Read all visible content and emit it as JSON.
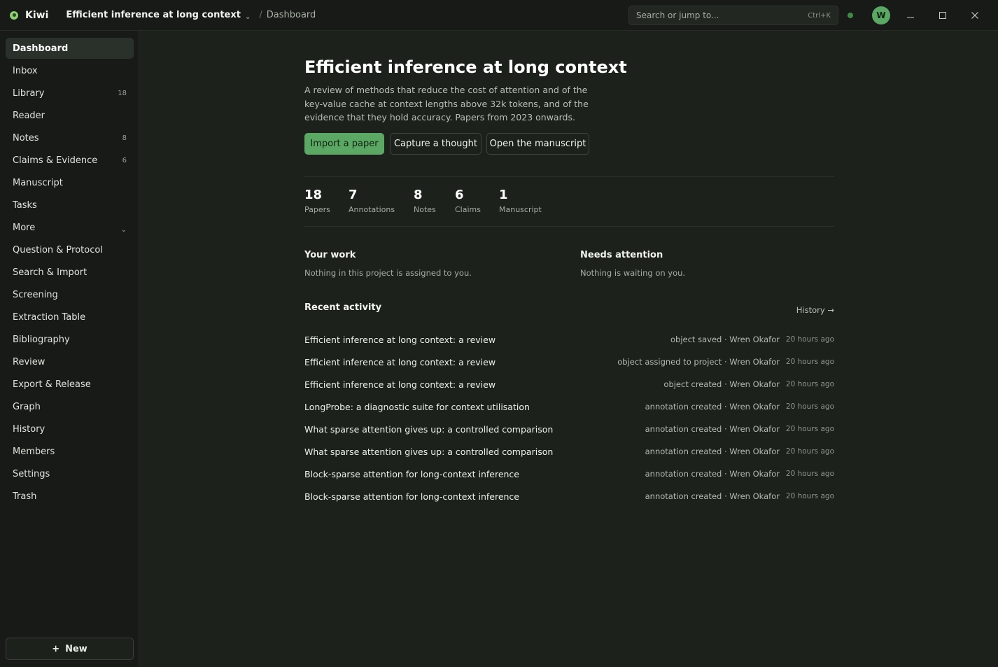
{
  "app": {
    "name": "Kiwi",
    "project": "Efficient inference at long context",
    "breadcrumb": "Dashboard"
  },
  "search": {
    "placeholder": "Search or jump to...",
    "shortcut": "Ctrl+K"
  },
  "user": {
    "initial": "W"
  },
  "window": {
    "minimize": "–",
    "maximize": "☐",
    "close": "✕"
  },
  "sidebar": {
    "items": [
      {
        "label": "Dashboard",
        "count": ""
      },
      {
        "label": "Inbox",
        "count": ""
      },
      {
        "label": "Library",
        "count": "18"
      },
      {
        "label": "Reader",
        "count": ""
      },
      {
        "label": "Notes",
        "count": "8"
      },
      {
        "label": "Claims & Evidence",
        "count": "6"
      },
      {
        "label": "Manuscript",
        "count": ""
      },
      {
        "label": "Tasks",
        "count": ""
      },
      {
        "label": "More",
        "count": ""
      },
      {
        "label": "Question & Protocol",
        "count": ""
      },
      {
        "label": "Search & Import",
        "count": ""
      },
      {
        "label": "Screening",
        "count": ""
      },
      {
        "label": "Extraction Table",
        "count": ""
      },
      {
        "label": "Bibliography",
        "count": ""
      },
      {
        "label": "Review",
        "count": ""
      },
      {
        "label": "Export & Release",
        "count": ""
      },
      {
        "label": "Graph",
        "count": ""
      },
      {
        "label": "History",
        "count": ""
      },
      {
        "label": "Members",
        "count": ""
      },
      {
        "label": "Settings",
        "count": ""
      },
      {
        "label": "Trash",
        "count": ""
      }
    ],
    "more_chevron": "⌄",
    "new_button": {
      "plus": "+",
      "label": "New"
    }
  },
  "main": {
    "title": "Efficient inference at long context",
    "description": "A review of methods that reduce the cost of attention and of the key-value cache at context lengths above 32k tokens, and of the evidence that they hold accuracy. Papers from 2023 onwards.",
    "actions": {
      "import": "Import a paper",
      "capture": "Capture a thought",
      "manuscript": "Open the manuscript"
    },
    "stats": [
      {
        "value": "18",
        "label": "Papers"
      },
      {
        "value": "7",
        "label": "Annotations"
      },
      {
        "value": "8",
        "label": "Notes"
      },
      {
        "value": "6",
        "label": "Claims"
      },
      {
        "value": "1",
        "label": "Manuscript"
      }
    ],
    "your_work": {
      "heading": "Your work",
      "text": "Nothing in this project is assigned to you."
    },
    "needs_attention": {
      "heading": "Needs attention",
      "text": "Nothing is waiting on you."
    },
    "recent": {
      "heading": "Recent activity",
      "history_link": "History →",
      "rows": [
        {
          "title": "Efficient inference at long context: a review",
          "meta": "object saved · Wren Okafor",
          "time": "20 hours ago"
        },
        {
          "title": "Efficient inference at long context: a review",
          "meta": "object assigned to project · Wren Okafor",
          "time": "20 hours ago"
        },
        {
          "title": "Efficient inference at long context: a review",
          "meta": "object created · Wren Okafor",
          "time": "20 hours ago"
        },
        {
          "title": "LongProbe: a diagnostic suite for context utilisation",
          "meta": "annotation created · Wren Okafor",
          "time": "20 hours ago"
        },
        {
          "title": "What sparse attention gives up: a controlled comparison",
          "meta": "annotation created · Wren Okafor",
          "time": "20 hours ago"
        },
        {
          "title": "What sparse attention gives up: a controlled comparison",
          "meta": "annotation created · Wren Okafor",
          "time": "20 hours ago"
        },
        {
          "title": "Block-sparse attention for long-context inference",
          "meta": "annotation created · Wren Okafor",
          "time": "20 hours ago"
        },
        {
          "title": "Block-sparse attention for long-context inference",
          "meta": "annotation created · Wren Okafor",
          "time": "20 hours ago"
        }
      ]
    }
  }
}
